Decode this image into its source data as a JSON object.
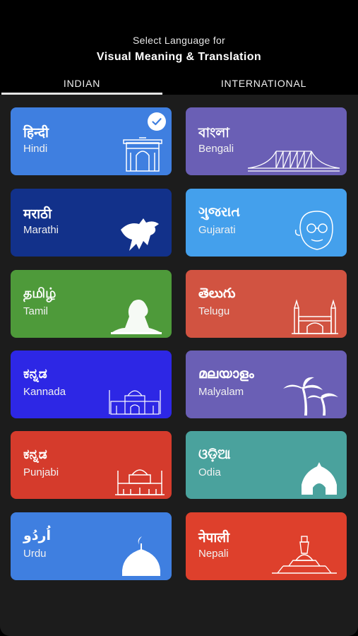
{
  "header": {
    "subtitle": "Select Language for",
    "title": "Visual Meaning & Translation"
  },
  "tabs": [
    {
      "label": "INDIAN",
      "selected": true
    },
    {
      "label": "INTERNATIONAL",
      "selected": false
    }
  ],
  "languages": [
    {
      "native": "हिन्दी",
      "name": "Hindi",
      "color": "#3f7fe0",
      "icon": "india-gate-icon",
      "selected": true
    },
    {
      "native": "বাংলা",
      "name": "Bengali",
      "color": "#6a5fb5",
      "icon": "howrah-bridge-icon",
      "selected": false
    },
    {
      "native": "मराठी",
      "name": "Marathi",
      "color": "#12318a",
      "icon": "horse-rider-icon",
      "selected": false
    },
    {
      "native": "ગુજરાત",
      "name": "Gujarati",
      "color": "#44a0ec",
      "icon": "gandhi-portrait-icon",
      "selected": false
    },
    {
      "native": "தமிழ்",
      "name": "Tamil",
      "color": "#4e9a3a",
      "icon": "saint-statue-icon",
      "selected": false
    },
    {
      "native": "తెలుగు",
      "name": "Telugu",
      "color": "#d15341",
      "icon": "charminar-icon",
      "selected": false
    },
    {
      "native": "ಕನ್ನಡ",
      "name": "Kannada",
      "color": "#2d27e5",
      "icon": "palace-icon",
      "selected": false
    },
    {
      "native": "മലയാളം",
      "name": "Malyalam",
      "color": "#6a5fb5",
      "icon": "palm-tree-icon",
      "selected": false
    },
    {
      "native": "ಕನ್ನಡ",
      "name": "Punjabi",
      "color": "#d53b2c",
      "icon": "golden-temple-icon",
      "selected": false
    },
    {
      "native": "ଓଡ଼ିଆ",
      "name": "Odia",
      "color": "#4aa29d",
      "icon": "temple-arch-icon",
      "selected": false
    },
    {
      "native": "اُردُو",
      "name": "Urdu",
      "color": "#3f7fe0",
      "icon": "mosque-dome-icon",
      "selected": false
    },
    {
      "native": "नेपाली",
      "name": "Nepali",
      "color": "#de402c",
      "icon": "stupa-icon",
      "selected": false
    }
  ]
}
